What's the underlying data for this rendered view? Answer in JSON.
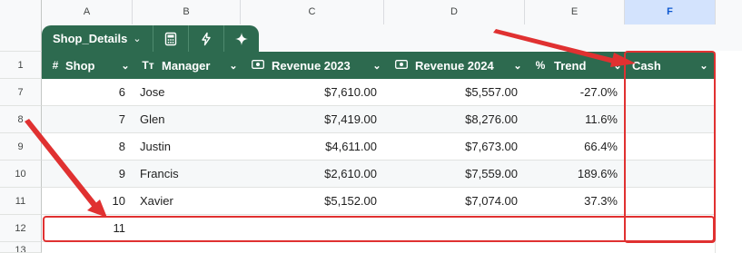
{
  "sheet": {
    "columns": [
      "A",
      "B",
      "C",
      "D",
      "E",
      "F"
    ],
    "selected_column": "F"
  },
  "table_tab": {
    "name": "Shop_Details",
    "tools": [
      "calculator-icon",
      "bolt-icon",
      "sparkle-icon"
    ]
  },
  "table_header": {
    "row_number": "1",
    "columns": [
      {
        "icon": "#",
        "label": "Shop"
      },
      {
        "icon": "Tт",
        "label": "Manager"
      },
      {
        "icon": "money-icon",
        "label": "Revenue 2023"
      },
      {
        "icon": "money-icon",
        "label": "Revenue 2024"
      },
      {
        "icon": "%",
        "label": "Trend"
      },
      {
        "icon": "",
        "label": "Cash"
      }
    ]
  },
  "rows": [
    {
      "row_number": "7",
      "shop": "6",
      "manager": "Jose",
      "rev2023": "$7,610.00",
      "rev2024": "$5,557.00",
      "trend": "-27.0%",
      "cash": ""
    },
    {
      "row_number": "8",
      "shop": "7",
      "manager": "Glen",
      "rev2023": "$7,419.00",
      "rev2024": "$8,276.00",
      "trend": "11.6%",
      "cash": ""
    },
    {
      "row_number": "9",
      "shop": "8",
      "manager": "Justin",
      "rev2023": "$4,611.00",
      "rev2024": "$7,673.00",
      "trend": "66.4%",
      "cash": ""
    },
    {
      "row_number": "10",
      "shop": "9",
      "manager": "Francis",
      "rev2023": "$2,610.00",
      "rev2024": "$7,559.00",
      "trend": "189.6%",
      "cash": ""
    },
    {
      "row_number": "11",
      "shop": "10",
      "manager": "Xavier",
      "rev2023": "$5,152.00",
      "rev2024": "$7,074.00",
      "trend": "37.3%",
      "cash": ""
    },
    {
      "row_number": "12",
      "shop": "11",
      "manager": "",
      "rev2023": "",
      "rev2024": "",
      "trend": "",
      "cash": ""
    }
  ],
  "extra_row_number": "13",
  "colors": {
    "table_header": "#2d6a4f",
    "annotation": "#e03131",
    "selected_column": "#d3e3fd"
  }
}
